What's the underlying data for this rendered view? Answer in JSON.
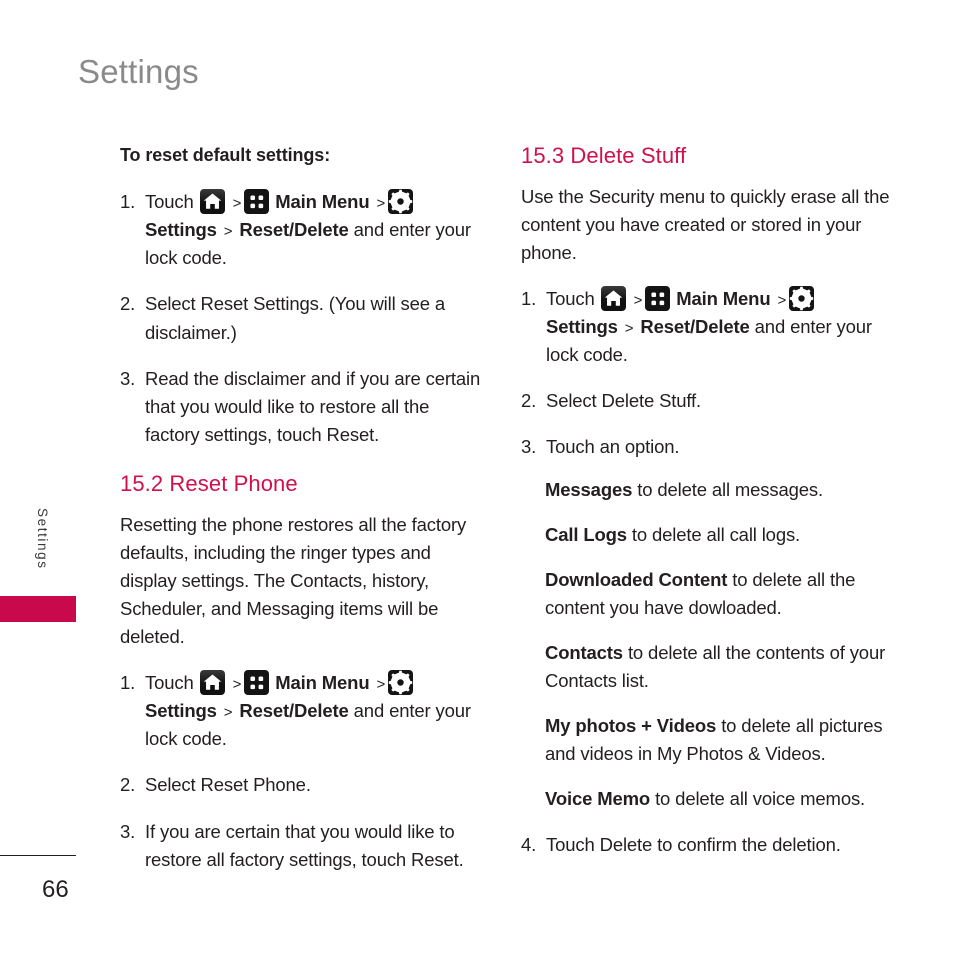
{
  "page": {
    "title": "Settings",
    "side_tab_label": "Settings",
    "page_number": "66",
    "accent_color": "#c8094c",
    "heading_color": "#d0104b",
    "title_color": "#8a8a8a"
  },
  "icons": {
    "home": "home-icon",
    "grid": "main-menu-grid-icon",
    "gear": "settings-gear-icon"
  },
  "left_column": {
    "lead_in": "To reset default settings:",
    "steps_reset_default": [
      {
        "num": "1.",
        "parts": [
          {
            "type": "text",
            "value": "Touch "
          },
          {
            "type": "icon",
            "value": "home"
          },
          {
            "type": "sep",
            "value": ">"
          },
          {
            "type": "icon",
            "value": "grid"
          },
          {
            "type": "bold",
            "value": "Main Menu"
          },
          {
            "type": "sep",
            "value": ">"
          },
          {
            "type": "icon",
            "value": "gear"
          },
          {
            "type": "bold",
            "value": "Settings"
          },
          {
            "type": "sep",
            "value": ">"
          },
          {
            "type": "bold",
            "value": "Reset/Delete"
          },
          {
            "type": "text",
            "value": " and enter your lock code."
          }
        ]
      },
      {
        "num": "2.",
        "text": "Select Reset Settings. (You will see a disclaimer.)"
      },
      {
        "num": "3.",
        "text": "Read the disclaimer and if you are certain that you would like to restore all the factory settings, touch Reset."
      }
    ],
    "section": {
      "heading": "15.2 Reset Phone",
      "body": "Resetting the phone restores all the factory defaults, including the ringer types and display settings. The Contacts, history, Scheduler, and Messaging items will be deleted.",
      "steps": [
        {
          "num": "1.",
          "parts": [
            {
              "type": "text",
              "value": "Touch "
            },
            {
              "type": "icon",
              "value": "home"
            },
            {
              "type": "sep",
              "value": ">"
            },
            {
              "type": "icon",
              "value": "grid"
            },
            {
              "type": "bold",
              "value": "Main Menu"
            },
            {
              "type": "sep",
              "value": ">"
            },
            {
              "type": "icon",
              "value": "gear"
            },
            {
              "type": "bold",
              "value": "Settings"
            },
            {
              "type": "sep",
              "value": ">"
            },
            {
              "type": "bold",
              "value": "Reset/Delete"
            },
            {
              "type": "text",
              "value": " and enter your lock code."
            }
          ]
        },
        {
          "num": "2.",
          "text": "Select Reset Phone."
        },
        {
          "num": "3.",
          "text": "If you are certain that you would like to restore all factory settings, touch Reset."
        }
      ]
    }
  },
  "right_column": {
    "section": {
      "heading": "15.3 Delete Stuff",
      "body": "Use the Security menu to quickly erase all the content you have created or stored in your phone.",
      "steps": [
        {
          "num": "1.",
          "parts": [
            {
              "type": "text",
              "value": "Touch "
            },
            {
              "type": "icon",
              "value": "home"
            },
            {
              "type": "sep",
              "value": ">"
            },
            {
              "type": "icon",
              "value": "grid"
            },
            {
              "type": "bold",
              "value": "Main Menu"
            },
            {
              "type": "sep",
              "value": ">"
            },
            {
              "type": "icon",
              "value": "gear"
            },
            {
              "type": "bold",
              "value": "Settings"
            },
            {
              "type": "sep",
              "value": ">"
            },
            {
              "type": "bold",
              "value": "Reset/Delete"
            },
            {
              "type": "text",
              "value": " and enter your lock code."
            }
          ]
        },
        {
          "num": "2.",
          "text": "Select Delete Stuff."
        },
        {
          "num": "3.",
          "text": "Touch an option."
        }
      ],
      "options": [
        {
          "label": "Messages",
          "desc": " to delete all messages."
        },
        {
          "label": "Call Logs",
          "desc": " to delete all call logs."
        },
        {
          "label": "Downloaded Content",
          "desc": " to delete all the content you have dowloaded."
        },
        {
          "label": "Contacts",
          "desc": " to delete all the contents of your Contacts list."
        },
        {
          "label": "My photos + Videos",
          "desc": " to delete all pictures and videos in My Photos & Videos."
        },
        {
          "label": "Voice Memo",
          "desc": " to delete all voice memos."
        }
      ],
      "final_step": {
        "num": "4.",
        "text": "Touch Delete to confirm the deletion."
      }
    }
  }
}
